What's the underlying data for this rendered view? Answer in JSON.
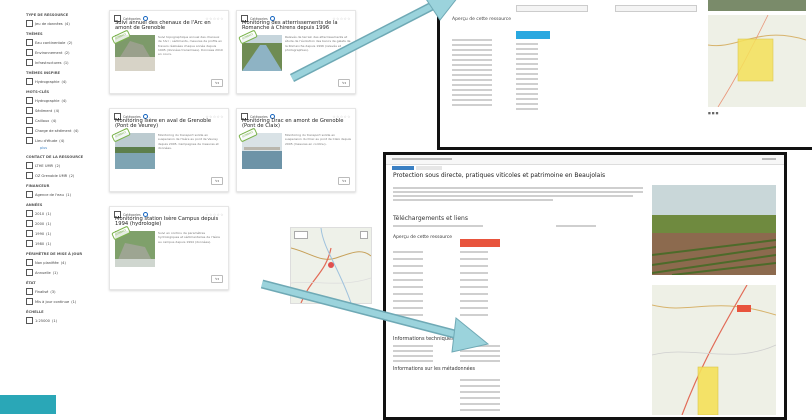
{
  "sidebar": {
    "groups": [
      {
        "title": "TYPE DE RESSOURCE",
        "items": [
          {
            "label": "Jeu de données",
            "count": "(4)",
            "checked": true
          }
        ]
      },
      {
        "title": "THÈMES",
        "items": [
          {
            "label": "Eau continentale",
            "count": "(2)"
          },
          {
            "label": "Environnement",
            "count": "(2)"
          },
          {
            "label": "Infrastructures",
            "count": "(1)"
          }
        ]
      },
      {
        "title": "THÈMES INSPIRE",
        "items": [
          {
            "label": "Hydrographie",
            "count": "(4)"
          }
        ]
      },
      {
        "title": "MOTS-CLÉS",
        "items": [
          {
            "label": "Hydrographie",
            "count": "(4)"
          },
          {
            "label": "Sédiment",
            "count": "(4)"
          },
          {
            "label": "Cailloux",
            "count": "(4)"
          },
          {
            "label": "Charge de sédiment",
            "count": "(4)"
          },
          {
            "label": "Lieu d'étude",
            "count": "(4)"
          }
        ],
        "more": "plus"
      },
      {
        "title": "CONTACT DE LA RESSOURCE",
        "items": [
          {
            "label": "LTHE UMR",
            "count": "(2)"
          },
          {
            "label": "OZ Grenoble UMR",
            "count": "(2)"
          }
        ]
      },
      {
        "title": "FINANCEUR",
        "items": [
          {
            "label": "Agence de l'eau",
            "count": "(1)"
          }
        ]
      },
      {
        "title": "ANNÉES",
        "items": [
          {
            "label": "2010",
            "count": "(1)"
          },
          {
            "label": "2000",
            "count": "(1)"
          },
          {
            "label": "1990",
            "count": "(1)"
          },
          {
            "label": "1980",
            "count": "(1)"
          }
        ]
      },
      {
        "title": "PÉRIMÈTRE DE MISE À JOUR",
        "items": [
          {
            "label": "Non planifiée",
            "count": "(4)"
          },
          {
            "label": "Annuelle",
            "count": "(1)"
          }
        ]
      },
      {
        "title": "ÉTAT",
        "items": [
          {
            "label": "Finalisé",
            "count": "(3)"
          },
          {
            "label": "Mis à jour continue",
            "count": "(1)"
          }
        ]
      },
      {
        "title": "ÉCHELLE",
        "items": [
          {
            "label": "1:25000",
            "count": "(1)"
          }
        ]
      }
    ]
  },
  "cards": [
    {
      "category": "Catégories",
      "title": "Suivi annuel des chenaux de l'Arc en amont de Grenoble",
      "desc": "Suivi topographique annuel des chenaux de l'Arc ; sédiments, mesures de profils en travers réalisées chaque année depuis 1995 (données transmises). Données 2010 en cours.",
      "thumb": "cliff",
      "ribbon": "DONNÉES"
    },
    {
      "category": "Catégories",
      "title": "Monitoring des atterrissements de la Romanche à Chirens depuis 1996",
      "desc": "Relevés de terrain des atterrissements et étude de l'évolution des bancs de galets de la Romanche depuis 1996 (relevés et photographies).",
      "thumb": "river",
      "ribbon": "DONNÉES"
    },
    {
      "category": "Catégories",
      "title": "Monitoring Isère en aval de Grenoble (Pont de Veurey)",
      "desc": "Monitoring du transport solide en suspension de l'Isère au pont de Veurey depuis 2005. Campagnes de mesures et données.",
      "thumb": "lake",
      "ribbon": "DONNÉES"
    },
    {
      "category": "Catégories",
      "title": "Monitoring Drac en amont de Grenoble (Pont de Claix)",
      "desc": "Monitoring du transport solide en suspension du Drac au pont de Claix depuis 2005 (mesures en continu).",
      "thumb": "bridge",
      "ribbon": "DONNÉES"
    },
    {
      "category": "Catégories",
      "title": "Monitoring station Isère Campus depuis 1994 (hydrologie)",
      "desc": "Suivi en continu de paramètres hydrologiques et sédimentaires de l'Isère au campus depuis 1994 (données).",
      "thumb": "cliff2",
      "ribbon": "DONNÉES"
    }
  ],
  "card_button": "✎▾",
  "stars": "☆☆☆☆☆",
  "bottom_panel": {
    "title": "Protection sous directe, pratiques viticoles et patrimoine en Beaujolais",
    "section1": "Téléchargements et liens",
    "section2": "Aperçu de cette ressource",
    "section3": "Informations techniques",
    "section4": "Informations sur les métadonnées"
  },
  "top_panel": {
    "section": "Aperçu de cette ressource"
  },
  "colors": {
    "accent_blue": "#3b80c3",
    "map_highlight": "#f5e15a",
    "arrow": "#8cc8d2",
    "teal_button": "#2aa7b7",
    "red_badge": "#e8543d"
  }
}
